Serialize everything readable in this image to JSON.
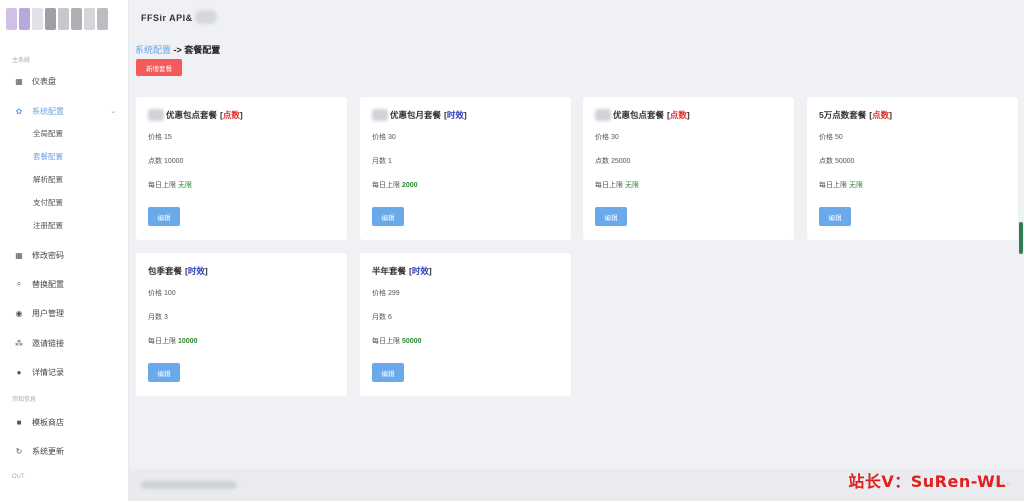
{
  "app": {
    "title": "FFSir API&"
  },
  "logo": {
    "colors": [
      "#cfc0e8",
      "#b7a8de",
      "#e4e0ea",
      "#9f9fa5",
      "#c8c8cc",
      "#b0b0b4",
      "#d6d6da",
      "#bdbdc1"
    ]
  },
  "sidebar": {
    "section_main": "主系统",
    "section_notice": "须知信息",
    "section_out": "OUT",
    "items": [
      {
        "label": "仪表盘",
        "icon": "dashboard-icon",
        "glyph": "▦"
      },
      {
        "label": "系统配置",
        "icon": "gear-icon",
        "glyph": "✿"
      },
      {
        "label": "修改密码",
        "icon": "grid-icon",
        "glyph": "▦"
      },
      {
        "label": "替换配置",
        "icon": "search-icon",
        "glyph": "⌕"
      },
      {
        "label": "用户管理",
        "icon": "user-icon",
        "glyph": "◉"
      },
      {
        "label": "邀请链接",
        "icon": "group-icon",
        "glyph": "⁂"
      },
      {
        "label": "详情记录",
        "icon": "dot-icon",
        "glyph": "●"
      },
      {
        "label": "模板商店",
        "icon": "bag-icon",
        "glyph": "■"
      },
      {
        "label": "系统更新",
        "icon": "refresh-icon",
        "glyph": "↻"
      }
    ],
    "sub_items": [
      "全局配置",
      "套餐配置",
      "解析配置",
      "支付配置",
      "注册配置"
    ],
    "active_sub": "套餐配置",
    "chevron": "⌄"
  },
  "breadcrumb": {
    "link": "系统配置",
    "separator": " -> ",
    "current": "套餐配置"
  },
  "actions": {
    "add_label": "新增套餐"
  },
  "labels": {
    "bracket_open": "[ ",
    "bracket_close": " ]",
    "edit": "编辑"
  },
  "cards": [
    {
      "name": "优惠包点套餐",
      "blurred": true,
      "tag": "点数",
      "tag_type": "red",
      "rows": [
        {
          "label": "价格",
          "value": "15"
        },
        {
          "label": "点数",
          "value": "10000"
        },
        {
          "label": "每日上限",
          "value": "无限",
          "style": "green-n"
        }
      ]
    },
    {
      "name": "优惠包月套餐",
      "blurred": true,
      "tag": "时效",
      "tag_type": "blue",
      "rows": [
        {
          "label": "价格",
          "value": "30"
        },
        {
          "label": "月数",
          "value": "1"
        },
        {
          "label": "每日上限",
          "value": "2000",
          "style": "green"
        }
      ]
    },
    {
      "name": "优惠包点套餐",
      "blurred": true,
      "tag": "点数",
      "tag_type": "red",
      "rows": [
        {
          "label": "价格",
          "value": "30"
        },
        {
          "label": "点数",
          "value": "25000"
        },
        {
          "label": "每日上限",
          "value": "无限",
          "style": "green-n"
        }
      ]
    },
    {
      "name": "5万点数套餐",
      "blurred": false,
      "tag": "点数",
      "tag_type": "red",
      "rows": [
        {
          "label": "价格",
          "value": "50"
        },
        {
          "label": "点数",
          "value": "50000"
        },
        {
          "label": "每日上限",
          "value": "无限",
          "style": "green-n"
        }
      ]
    },
    {
      "name": "包季套餐",
      "blurred": false,
      "tag": "时效",
      "tag_type": "blue",
      "rows": [
        {
          "label": "价格",
          "value": "100"
        },
        {
          "label": "月数",
          "value": "3"
        },
        {
          "label": "每日上限",
          "value": "10000",
          "style": "green"
        }
      ]
    },
    {
      "name": "半年套餐",
      "blurred": false,
      "tag": "时效",
      "tag_type": "blue",
      "rows": [
        {
          "label": "价格",
          "value": "299"
        },
        {
          "label": "月数",
          "value": "6"
        },
        {
          "label": "每日上限",
          "value": "50000",
          "style": "green"
        }
      ]
    }
  ],
  "footer": {
    "version": "Version 1.0"
  },
  "watermark": "站长V：SuRen-WL"
}
